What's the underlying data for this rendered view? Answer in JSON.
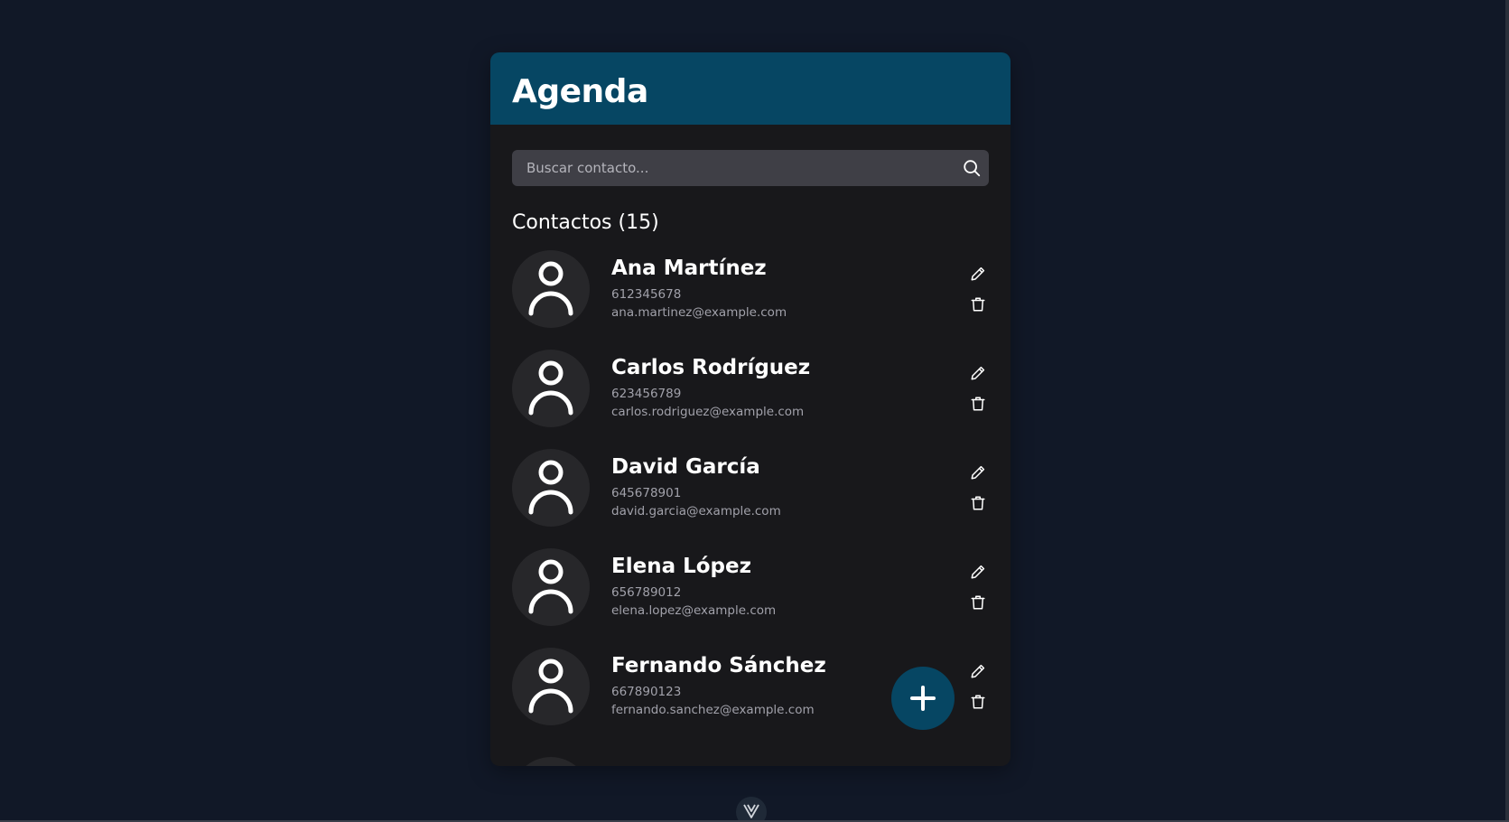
{
  "app": {
    "title": "Agenda",
    "brand_color": "#064663"
  },
  "search": {
    "placeholder": "Buscar contacto...",
    "value": "",
    "icon": "search-icon"
  },
  "contacts_section": {
    "title": "Contactos (15)"
  },
  "contacts": [
    {
      "name": "Ana Martínez",
      "phone": "612345678",
      "email": "ana.martinez@example.com"
    },
    {
      "name": "Carlos Rodríguez",
      "phone": "623456789",
      "email": "carlos.rodriguez@example.com"
    },
    {
      "name": "David García",
      "phone": "645678901",
      "email": "david.garcia@example.com"
    },
    {
      "name": "Elena López",
      "phone": "656789012",
      "email": "elena.lopez@example.com"
    },
    {
      "name": "Fernando Sánchez",
      "phone": "667890123",
      "email": "fernando.sanchez@example.com"
    }
  ],
  "icons": {
    "avatar": "user-icon",
    "edit": "pencil-icon",
    "delete": "trash-icon",
    "add": "plus-icon",
    "devtools": "vue-devtools-icon"
  }
}
